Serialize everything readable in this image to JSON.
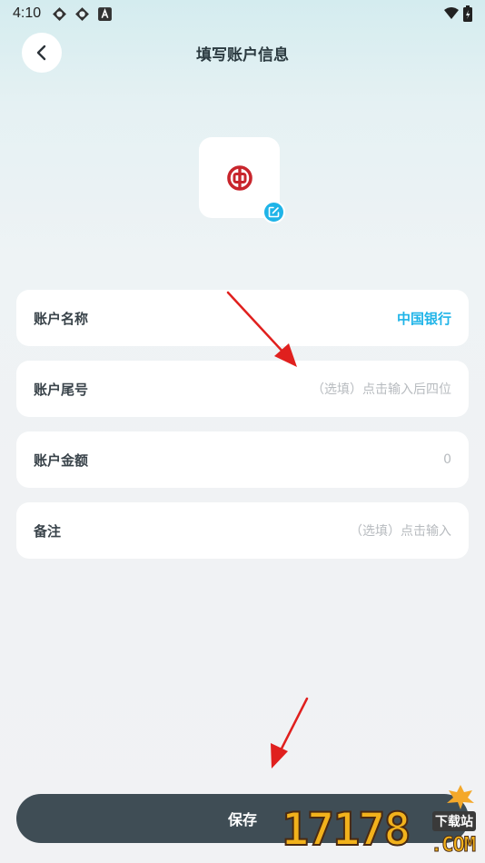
{
  "status_bar": {
    "time": "4:10",
    "icons": [
      "sync-icon",
      "sync-icon",
      "a-badge-icon",
      "wifi-icon",
      "battery-icon"
    ]
  },
  "header": {
    "title": "填写账户信息",
    "back_icon": "chevron-left-icon"
  },
  "bank": {
    "logo_icon": "bank-of-china-logo-icon",
    "logo_color": "#c8252c",
    "edit_icon": "edit-icon",
    "accent_color": "#1fb4e8"
  },
  "form": {
    "account_name": {
      "label": "账户名称",
      "value": "中国银行"
    },
    "account_tail": {
      "label": "账户尾号",
      "placeholder": "（选填）点击输入后四位"
    },
    "account_amount": {
      "label": "账户金额",
      "placeholder": "0"
    },
    "note": {
      "label": "备注",
      "placeholder": "（选填）点击输入"
    }
  },
  "footer": {
    "save_label": "保存",
    "save_color": "#3f4d55"
  },
  "watermark": {
    "number": "17178",
    "site": "下载站",
    "com": ".COM"
  }
}
